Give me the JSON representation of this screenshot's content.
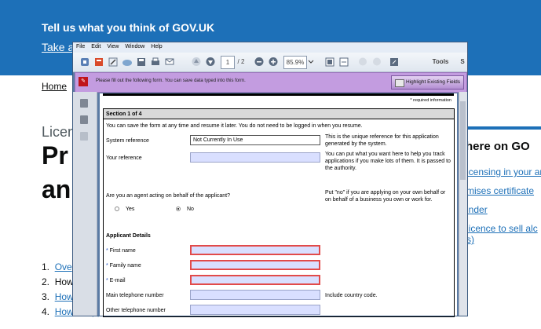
{
  "govuk": {
    "banner_title": "Tell us what you think of GOV.UK",
    "banner_link": "Take a",
    "breadcrumb_home": "Home",
    "caption": "Licen",
    "title_line1": "Pr",
    "title_line2": "an",
    "contents": [
      {
        "num": "1.",
        "label": "Ove",
        "link": true
      },
      {
        "num": "2.",
        "label": "How",
        "link": false
      },
      {
        "num": "3.",
        "label": "How",
        "link": true
      },
      {
        "num": "4.",
        "label": "How to apply",
        "link": true
      }
    ],
    "side_heading": "here on GO",
    "side_links": [
      "icensing in your ar",
      "mises certificate",
      "inder",
      "licence to sell alc",
      "s)"
    ]
  },
  "pdf": {
    "menu": [
      "File",
      "Edit",
      "View",
      "Window",
      "Help"
    ],
    "page_current": "1",
    "page_total": "/ 2",
    "zoom": "85.9%",
    "tools_label": "Tools",
    "sign_label": "S",
    "notify_text": "Please fill out the following form. You can save data typed into this form.",
    "highlight_button": "Highlight Existing Fields",
    "form": {
      "required_info": "* required information",
      "section": "Section 1 of 4",
      "intro": "You can save the form at any time and resume it later. You do not need to be logged in when you resume.",
      "system_ref_label": "System reference",
      "system_ref_value": "Not Currently In Use",
      "system_ref_note": "This is the unique reference for this application generated by the system.",
      "your_ref_label": "Your reference",
      "your_ref_note": "You can put what you want here to help you track applications if you make lots of them. It is passed to the authority.",
      "agent_question": "Are you an agent acting on behalf of the applicant?",
      "agent_note": "Put \"no\" if you are applying on your own behalf or on behalf of a business you own or work for.",
      "yes": "Yes",
      "no": "No",
      "agent_selected": "No",
      "applicant_heading": "Applicant Details",
      "first_name": "First name",
      "family_name": "Family name",
      "email": "E-mail",
      "main_phone": "Main telephone number",
      "phone_note": "Include country code.",
      "other_phone": "Other telephone number"
    }
  }
}
